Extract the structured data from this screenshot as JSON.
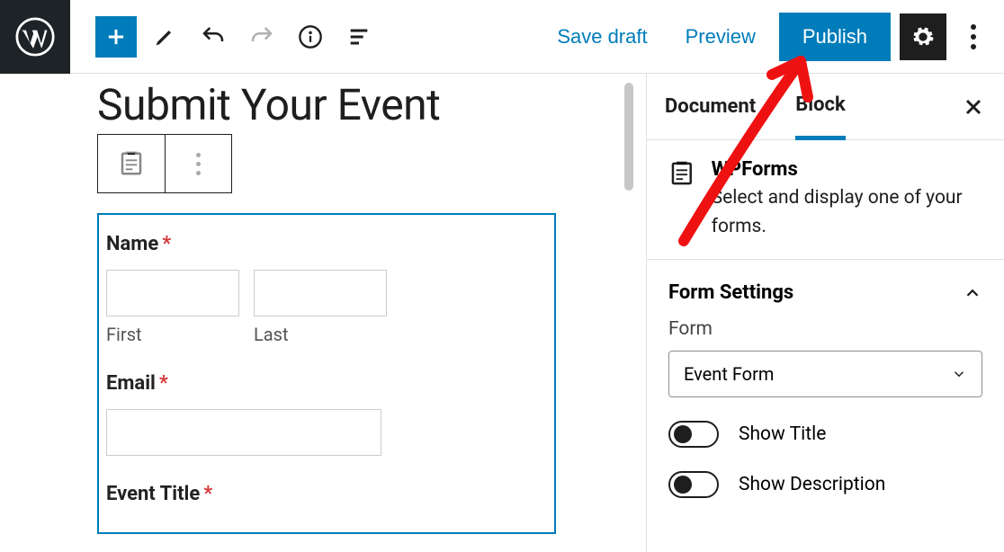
{
  "topbar": {
    "save_draft": "Save draft",
    "preview": "Preview",
    "publish": "Publish"
  },
  "page": {
    "title": "Submit Your Event"
  },
  "form": {
    "name_label": "Name",
    "first_sub": "First",
    "last_sub": "Last",
    "email_label": "Email",
    "event_title_label": "Event Title",
    "required_marker": "*"
  },
  "sidebar": {
    "tabs": {
      "document": "Document",
      "block": "Block"
    },
    "block_info": {
      "name": "WPForms",
      "desc": "Select and display one of your forms."
    },
    "form_settings": {
      "title": "Form Settings",
      "form_label": "Form",
      "selected_form": "Event Form",
      "show_title": "Show Title",
      "show_description": "Show Description"
    }
  }
}
